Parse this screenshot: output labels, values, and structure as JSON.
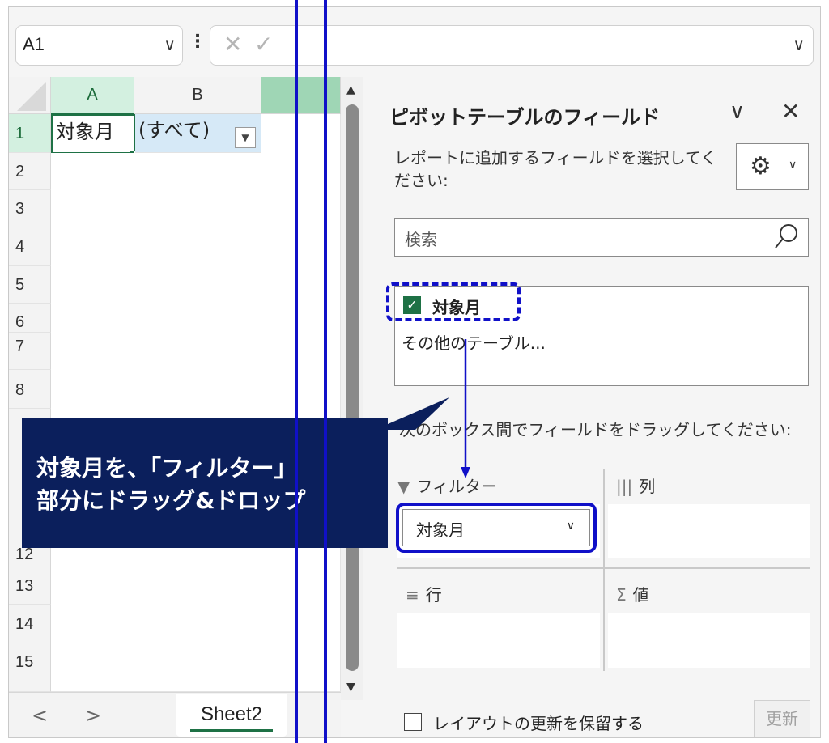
{
  "formula_bar": {
    "name_box": "A1",
    "chevron": "∨",
    "more": "⋮",
    "cancel": "✕",
    "enter": "✓",
    "expand": "∨"
  },
  "grid": {
    "columns": [
      "A",
      "B"
    ],
    "rows": [
      "1",
      "2",
      "3",
      "4",
      "5",
      "6",
      "7",
      "8",
      "12",
      "13",
      "14",
      "15"
    ],
    "cells": {
      "A1": "対象月",
      "B1": "(すべて)"
    },
    "filter_button": "▼"
  },
  "scrollbar": {
    "up": "▲",
    "down": "▼"
  },
  "sheet_tabs": {
    "prev": "<",
    "next": ">",
    "active": "Sheet2"
  },
  "pivot_pane": {
    "title": "ピボットテーブルのフィールド",
    "collapse": "∨",
    "close": "✕",
    "description": "レポートに追加するフィールドを選択してください:",
    "settings_chevron": "∨",
    "gear": "⚙",
    "search_placeholder": "検索",
    "fields": [
      {
        "label": "対象月",
        "checked": true
      }
    ],
    "more_tables": "その他のテーブル...",
    "drag_instruction": "次のボックス間でフィールドをドラッグしてください:",
    "areas": {
      "filter": {
        "label": "フィルター",
        "icon": "▼"
      },
      "columns": {
        "label": "列",
        "icon": "|||"
      },
      "rows": {
        "label": "行",
        "icon": "≡"
      },
      "values": {
        "label": "値",
        "icon": "Σ"
      }
    },
    "filter_item": {
      "label": "対象月",
      "chevron": "∨"
    },
    "defer_label": "レイアウトの更新を保留する",
    "update_button": "更新"
  },
  "callout": {
    "line1": "対象月を、「フィルター」",
    "line2": "部分にドラッグ&ドロップ"
  },
  "colors": {
    "excel_green": "#1e7145",
    "annotation_blue": "#1010c8",
    "callout_navy": "#0b1f5c",
    "selection_fill": "#d6e9f7"
  }
}
